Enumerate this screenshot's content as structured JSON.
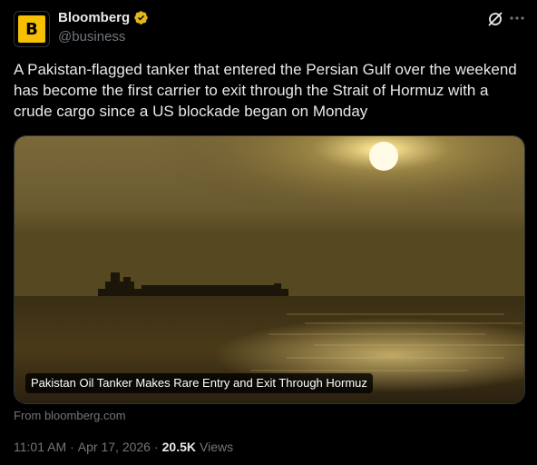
{
  "author": {
    "display_name": "Bloomberg",
    "handle": "@business",
    "avatar_letter": "B",
    "avatar_color": "#f6c000",
    "verified_color": "#e2b719"
  },
  "tweet": {
    "text": "A Pakistan-flagged tanker that entered the Persian Gulf over the weekend has become the first carrier to exit through the Strait of Hormuz with a crude cargo since a US blockade began on Monday"
  },
  "media": {
    "caption": "Pakistan Oil Tanker Makes Rare Entry and Exit Through Hormuz",
    "source": "From bloomberg.com"
  },
  "meta": {
    "time": "11:01 AM",
    "separator": "·",
    "date": "Apr 17, 2026",
    "views_count": "20.5K",
    "views_label": "Views"
  },
  "icons": {
    "grok": "grok-icon",
    "more": "more-icon",
    "verified": "verified-badge-icon"
  }
}
